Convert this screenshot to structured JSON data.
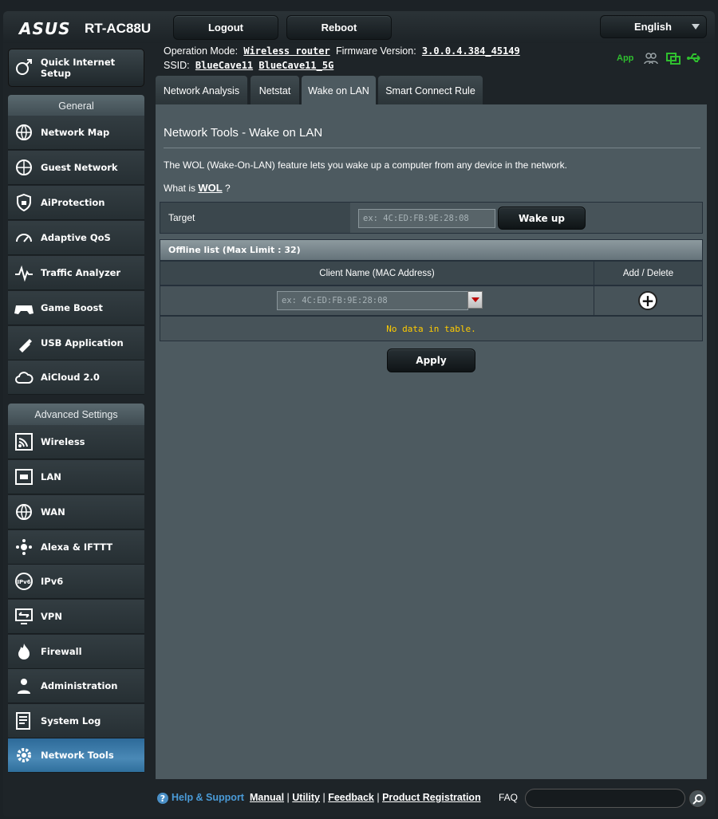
{
  "header": {
    "logo": "ASUS",
    "model": "RT-AC88U",
    "logout_label": "Logout",
    "reboot_label": "Reboot",
    "language": "English"
  },
  "status": {
    "op_mode_label": "Operation Mode:",
    "op_mode_value": "Wireless router",
    "firmware_label": "Firmware Version:",
    "firmware_value": "3.0.0.4.384_45149",
    "ssid_label": "SSID:",
    "ssid_1": "BlueCave11",
    "ssid_2": "BlueCave11_5G",
    "app_label": "App"
  },
  "sidebar": {
    "qis_label": "Quick Internet Setup",
    "general_heading": "General",
    "general_items": [
      {
        "label": "Network Map",
        "icon": "network-map-icon"
      },
      {
        "label": "Guest Network",
        "icon": "globe-icon"
      },
      {
        "label": "AiProtection",
        "icon": "shield-lock-icon"
      },
      {
        "label": "Adaptive QoS",
        "icon": "gauge-icon"
      },
      {
        "label": "Traffic Analyzer",
        "icon": "pulse-icon"
      },
      {
        "label": "Game Boost",
        "icon": "gamepad-icon"
      },
      {
        "label": "USB Application",
        "icon": "usb-icon"
      },
      {
        "label": "AiCloud 2.0",
        "icon": "cloud-icon"
      }
    ],
    "advanced_heading": "Advanced Settings",
    "advanced_items": [
      {
        "label": "Wireless",
        "icon": "wifi-icon"
      },
      {
        "label": "LAN",
        "icon": "lan-icon"
      },
      {
        "label": "WAN",
        "icon": "wan-globe-icon"
      },
      {
        "label": "Alexa & IFTTT",
        "icon": "alexa-icon"
      },
      {
        "label": "IPv6",
        "icon": "ipv6-icon"
      },
      {
        "label": "VPN",
        "icon": "vpn-icon"
      },
      {
        "label": "Firewall",
        "icon": "fire-icon"
      },
      {
        "label": "Administration",
        "icon": "admin-user-icon"
      },
      {
        "label": "System Log",
        "icon": "log-icon"
      },
      {
        "label": "Network Tools",
        "icon": "gear-tool-icon"
      }
    ]
  },
  "tabs": [
    {
      "label": "Network Analysis"
    },
    {
      "label": "Netstat"
    },
    {
      "label": "Wake on LAN"
    },
    {
      "label": "Smart Connect Rule"
    }
  ],
  "main": {
    "title": "Network Tools - Wake on LAN",
    "description": "The WOL (Wake-On-LAN) feature lets you wake up a computer from any device in the network.",
    "whatis_prefix": "What is",
    "whatis_link": "WOL",
    "whatis_suffix": "?",
    "target_label": "Target",
    "target_placeholder": "ex: 4C:ED:FB:9E:28:08",
    "wakeup_label": "Wake up",
    "offline_heading": "Offline list (Max Limit : 32)",
    "col_client": "Client Name (MAC Address)",
    "col_add_delete": "Add / Delete",
    "client_placeholder": "ex: 4C:ED:FB:9E:28:08",
    "no_data": "No data in table.",
    "apply_label": "Apply"
  },
  "footer": {
    "help_label": "Help & Support",
    "links": [
      "Manual",
      "Utility",
      "Feedback",
      "Product Registration"
    ],
    "faq_label": "FAQ"
  },
  "colors": {
    "panel_bg": "#4d5a60",
    "active_item": "#3a7db0",
    "app_green": "#2fbf2f",
    "no_data_yellow": "#ffcc00"
  }
}
